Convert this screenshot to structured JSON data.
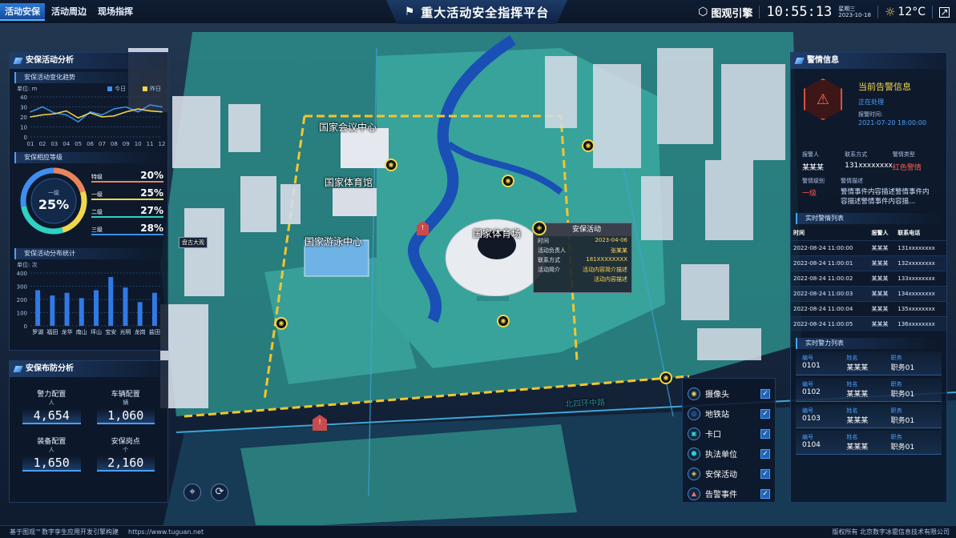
{
  "topbar": {
    "tabs": [
      "活动安保",
      "活动周边",
      "现场指挥"
    ],
    "active_tab": 0,
    "title": "重大活动安全指挥平台",
    "brand": "图观引擎",
    "time": "10:55:13",
    "weekday": "星期三",
    "date": "2023-10-18",
    "temperature": "12°C"
  },
  "left": {
    "analysis": {
      "title": "安保活动分析",
      "trend": {
        "subtitle": "安保活动变化趋势",
        "unit": "单位:  m",
        "legend_today": "今日",
        "legend_yesterday": "昨日"
      },
      "level": {
        "subtitle": "安保相应等级",
        "center_label": "一级",
        "center_value": "25%",
        "rows": [
          {
            "label": "特级",
            "value": "20%",
            "color": "#e8855b"
          },
          {
            "label": "一级",
            "value": "25%",
            "color": "#f2d64b"
          },
          {
            "label": "二级",
            "value": "27%",
            "color": "#2fd1c4"
          },
          {
            "label": "三级",
            "value": "28%",
            "color": "#3f8ef0"
          }
        ]
      },
      "dist": {
        "subtitle": "安保活动分布统计",
        "unit": "单位:  次"
      }
    },
    "defense": {
      "title": "安保布防分析",
      "items": [
        {
          "label": "警力配置",
          "unit": "人",
          "value": "4,654"
        },
        {
          "label": "车辆配置",
          "unit": "辆",
          "value": "1,060"
        },
        {
          "label": "装备配置",
          "unit": "人",
          "value": "1,650"
        },
        {
          "label": "安保岗点",
          "unit": "个",
          "value": "2,160"
        }
      ]
    }
  },
  "chart_data": [
    {
      "type": "line",
      "title": "安保活动变化趋势",
      "x": [
        "01",
        "02",
        "03",
        "04",
        "05",
        "06",
        "07",
        "08",
        "09",
        "10",
        "11",
        "12"
      ],
      "ylim": [
        0,
        40
      ],
      "yticks": [
        0,
        10,
        20,
        30,
        40
      ],
      "series": [
        {
          "name": "今日",
          "color": "#3f8ef0",
          "values": [
            25,
            30,
            24,
            22,
            15,
            25,
            22,
            28,
            30,
            25,
            32,
            30
          ]
        },
        {
          "name": "昨日",
          "color": "#f2d64b",
          "values": [
            20,
            22,
            23,
            26,
            19,
            24,
            20,
            21,
            25,
            28,
            26,
            25
          ]
        }
      ]
    },
    {
      "type": "bar",
      "title": "安保活动分布统计",
      "categories": [
        "罗湖",
        "福田",
        "龙华",
        "南山",
        "坪山",
        "宝安",
        "光明",
        "龙岗",
        "盐田"
      ],
      "values": [
        270,
        230,
        250,
        210,
        270,
        370,
        290,
        180,
        250
      ],
      "ylim": [
        0,
        400
      ],
      "yticks": [
        0,
        100,
        200,
        300,
        400
      ]
    }
  ],
  "map": {
    "labels": {
      "conf": "国家会议中心",
      "gym": "国家体育馆",
      "swim": "国家游泳中心",
      "stadium": "国家体育场",
      "road": "北四环中路",
      "pangu": "盘古大观"
    },
    "popup": {
      "title": "安保活动",
      "rows": [
        {
          "k": "时间",
          "v": "2023-04-06"
        },
        {
          "k": "活动负责人",
          "v": "张某某"
        },
        {
          "k": "联系方式",
          "v": "181XXXXXXXX"
        },
        {
          "k": "活动简介",
          "v": "活动内容简介描述"
        },
        {
          "k": "",
          "v": "活动内容描述"
        }
      ]
    }
  },
  "legend": [
    {
      "label": "摄像头",
      "icon": "camera-icon",
      "color": "#f2d64b",
      "glyph": "◉"
    },
    {
      "label": "地铁站",
      "icon": "subway-icon",
      "color": "#3f8ef0",
      "glyph": "◎"
    },
    {
      "label": "卡口",
      "icon": "checkpoint-icon",
      "color": "#2fd1c4",
      "glyph": "▣"
    },
    {
      "label": "执法单位",
      "icon": "police-unit-icon",
      "color": "#2fd1c4",
      "glyph": "⬢"
    },
    {
      "label": "安保活动",
      "icon": "security-activity-icon",
      "color": "#f2d64b",
      "glyph": "◈"
    },
    {
      "label": "告警事件",
      "icon": "alarm-event-icon",
      "color": "#f06b6b",
      "glyph": "▲"
    }
  ],
  "right": {
    "alarm": {
      "title": "警情信息",
      "current_title": "当前告警信息",
      "status": "正在处理",
      "time_label": "报警时间:",
      "time_value": "2021-07-20 18:00:00",
      "reporter_label": "报警人",
      "reporter_value": "某某某",
      "contact_label": "联系方式",
      "contact_value": "131xxxxxxxx",
      "type_label": "警情类型",
      "type_value": "红色警情",
      "level_label": "警情级别",
      "level_value": "一级",
      "desc_label": "警情描述",
      "desc_value": "警情事件内容描述警情事件内容描述警情事件内容描..."
    },
    "alarm_list": {
      "title": "实时警情列表",
      "headers": [
        "时间",
        "报警人",
        "联系电话"
      ],
      "rows": [
        [
          "2022-08-24 11:00:00",
          "某某某",
          "131xxxxxxxx"
        ],
        [
          "2022-08-24 11:00:01",
          "某某某",
          "132xxxxxxxx"
        ],
        [
          "2022-08-24 11:00:02",
          "某某某",
          "133xxxxxxxx"
        ],
        [
          "2022-08-24 11:00:03",
          "某某某",
          "134xxxxxxxx"
        ],
        [
          "2022-08-24 11:00:04",
          "某某某",
          "135xxxxxxxx"
        ],
        [
          "2022-08-24 11:00:05",
          "某某某",
          "136xxxxxxxx"
        ]
      ]
    },
    "police_list": {
      "title": "实时警力列表",
      "h_no": "编号",
      "h_name": "姓名",
      "h_job": "职务",
      "rows": [
        {
          "no": "0101",
          "name": "某某某",
          "job": "职务01"
        },
        {
          "no": "0102",
          "name": "某某某",
          "job": "职务01"
        },
        {
          "no": "0103",
          "name": "某某某",
          "job": "职务01"
        },
        {
          "no": "0104",
          "name": "某某某",
          "job": "职务01"
        }
      ]
    }
  },
  "footer": {
    "left": "基于图观™数字孪生应用开发引擎构建",
    "url": "https://www.tuguan.net",
    "right": "版权所有 北京数字冰雹信息技术有限公司"
  }
}
